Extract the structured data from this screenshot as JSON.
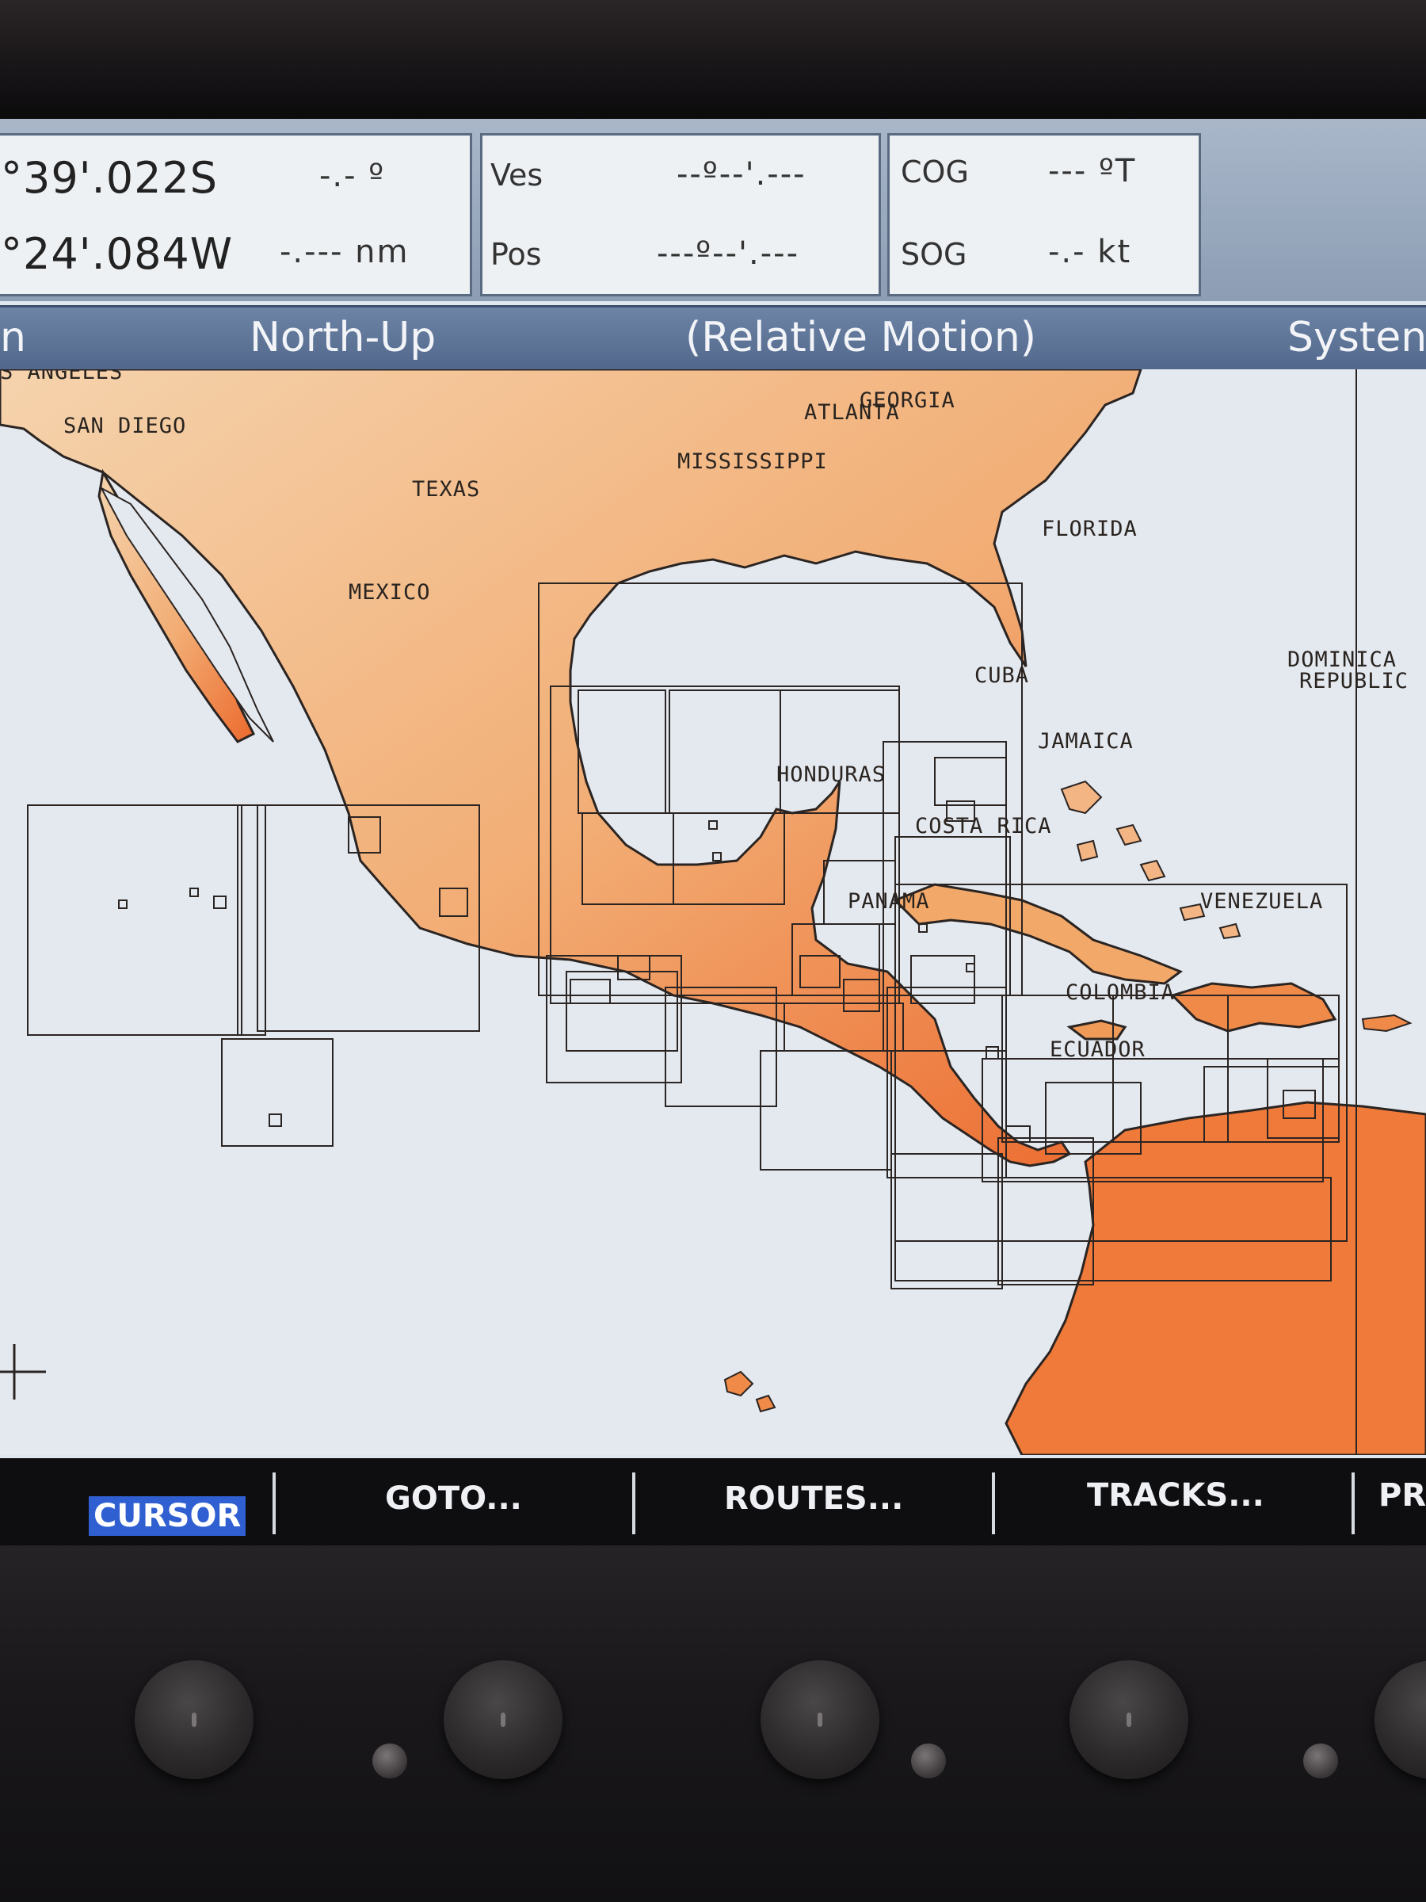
{
  "header": {
    "cursor_lat": "°39'.022S",
    "cursor_lon": "°24'.084W",
    "bearing": "-.- º",
    "range": "-.--- nm",
    "ves_label": "Ves",
    "pos_label": "Pos",
    "ves_value": "--º--'.---",
    "pos_value": "---º--'.---",
    "cog_label": "COG",
    "cog_value": "--- ºT",
    "sog_label": "SOG",
    "sog_value": "-.- kt"
  },
  "modebar": {
    "left_fragment": "n",
    "orientation": "North-Up",
    "motion": "(Relative Motion)",
    "right_fragment": "Systen"
  },
  "map": {
    "labels": {
      "los_angeles": "S ANGELES",
      "san_diego": "SAN DIEGO",
      "georgia": "GEORGIA",
      "atlanta": "ATLANTA",
      "mississippi": "MISSISSIPPI",
      "texas": "TEXAS",
      "florida": "FLORIDA",
      "mexico": "MEXICO",
      "cuba": "CUBA",
      "dominican": "DOMINICA",
      "republic": "REPUBLIC",
      "jamaica": "JAMAICA",
      "honduras": "HONDURAS",
      "costa_rica": "COSTA RICA",
      "panama": "PANAMA",
      "venezuela": "VENEZUELA",
      "colombia": "COLOMBIA",
      "ecuador": "ECUADOR"
    },
    "colors": {
      "water": "#e4e9ef",
      "land_light": "#f2c9a0",
      "land_dark": "#ee7a3c",
      "coverage_lines": "#2a2422"
    }
  },
  "softkeys": {
    "cursor": "CURSOR",
    "goto": "GOTO...",
    "routes": "ROUTES...",
    "tracks": "TRACKS...",
    "pr": "PR"
  }
}
